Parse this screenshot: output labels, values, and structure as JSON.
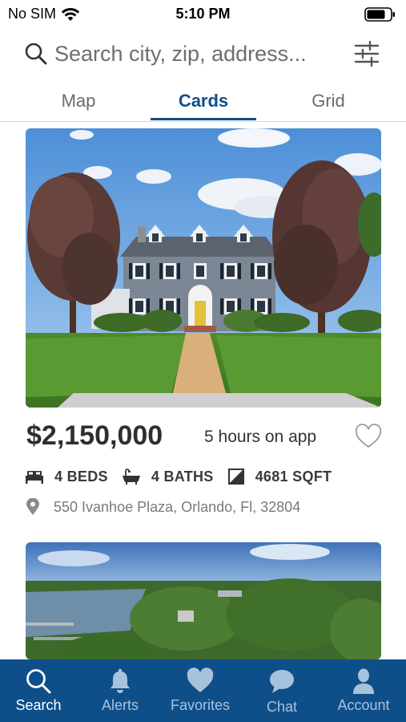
{
  "status_bar": {
    "carrier": "No SIM",
    "time": "5:10 PM"
  },
  "search": {
    "placeholder": "Search city, zip, address..."
  },
  "tabs": [
    {
      "label": "Map",
      "active": false
    },
    {
      "label": "Cards",
      "active": true
    },
    {
      "label": "Grid",
      "active": false
    }
  ],
  "listings": [
    {
      "price": "$2,150,000",
      "time_on_app": "5 hours on app",
      "beds": "4 BEDS",
      "baths": "4 BATHS",
      "sqft": "4681 SQFT",
      "address": "550 Ivanhoe Plaza, Orlando, Fl, 32804"
    }
  ],
  "bottom_nav": [
    {
      "label": "Search",
      "icon": "search-icon",
      "active": true
    },
    {
      "label": "Alerts",
      "icon": "bell-icon",
      "active": false
    },
    {
      "label": "Favorites",
      "icon": "heart-icon",
      "active": false
    },
    {
      "label": "Chat",
      "icon": "chat-bubble-icon",
      "active": false
    },
    {
      "label": "Account",
      "icon": "person-icon",
      "active": false
    }
  ],
  "colors": {
    "brand": "#0e4f8a",
    "nav_inactive": "#a9c2dc"
  }
}
